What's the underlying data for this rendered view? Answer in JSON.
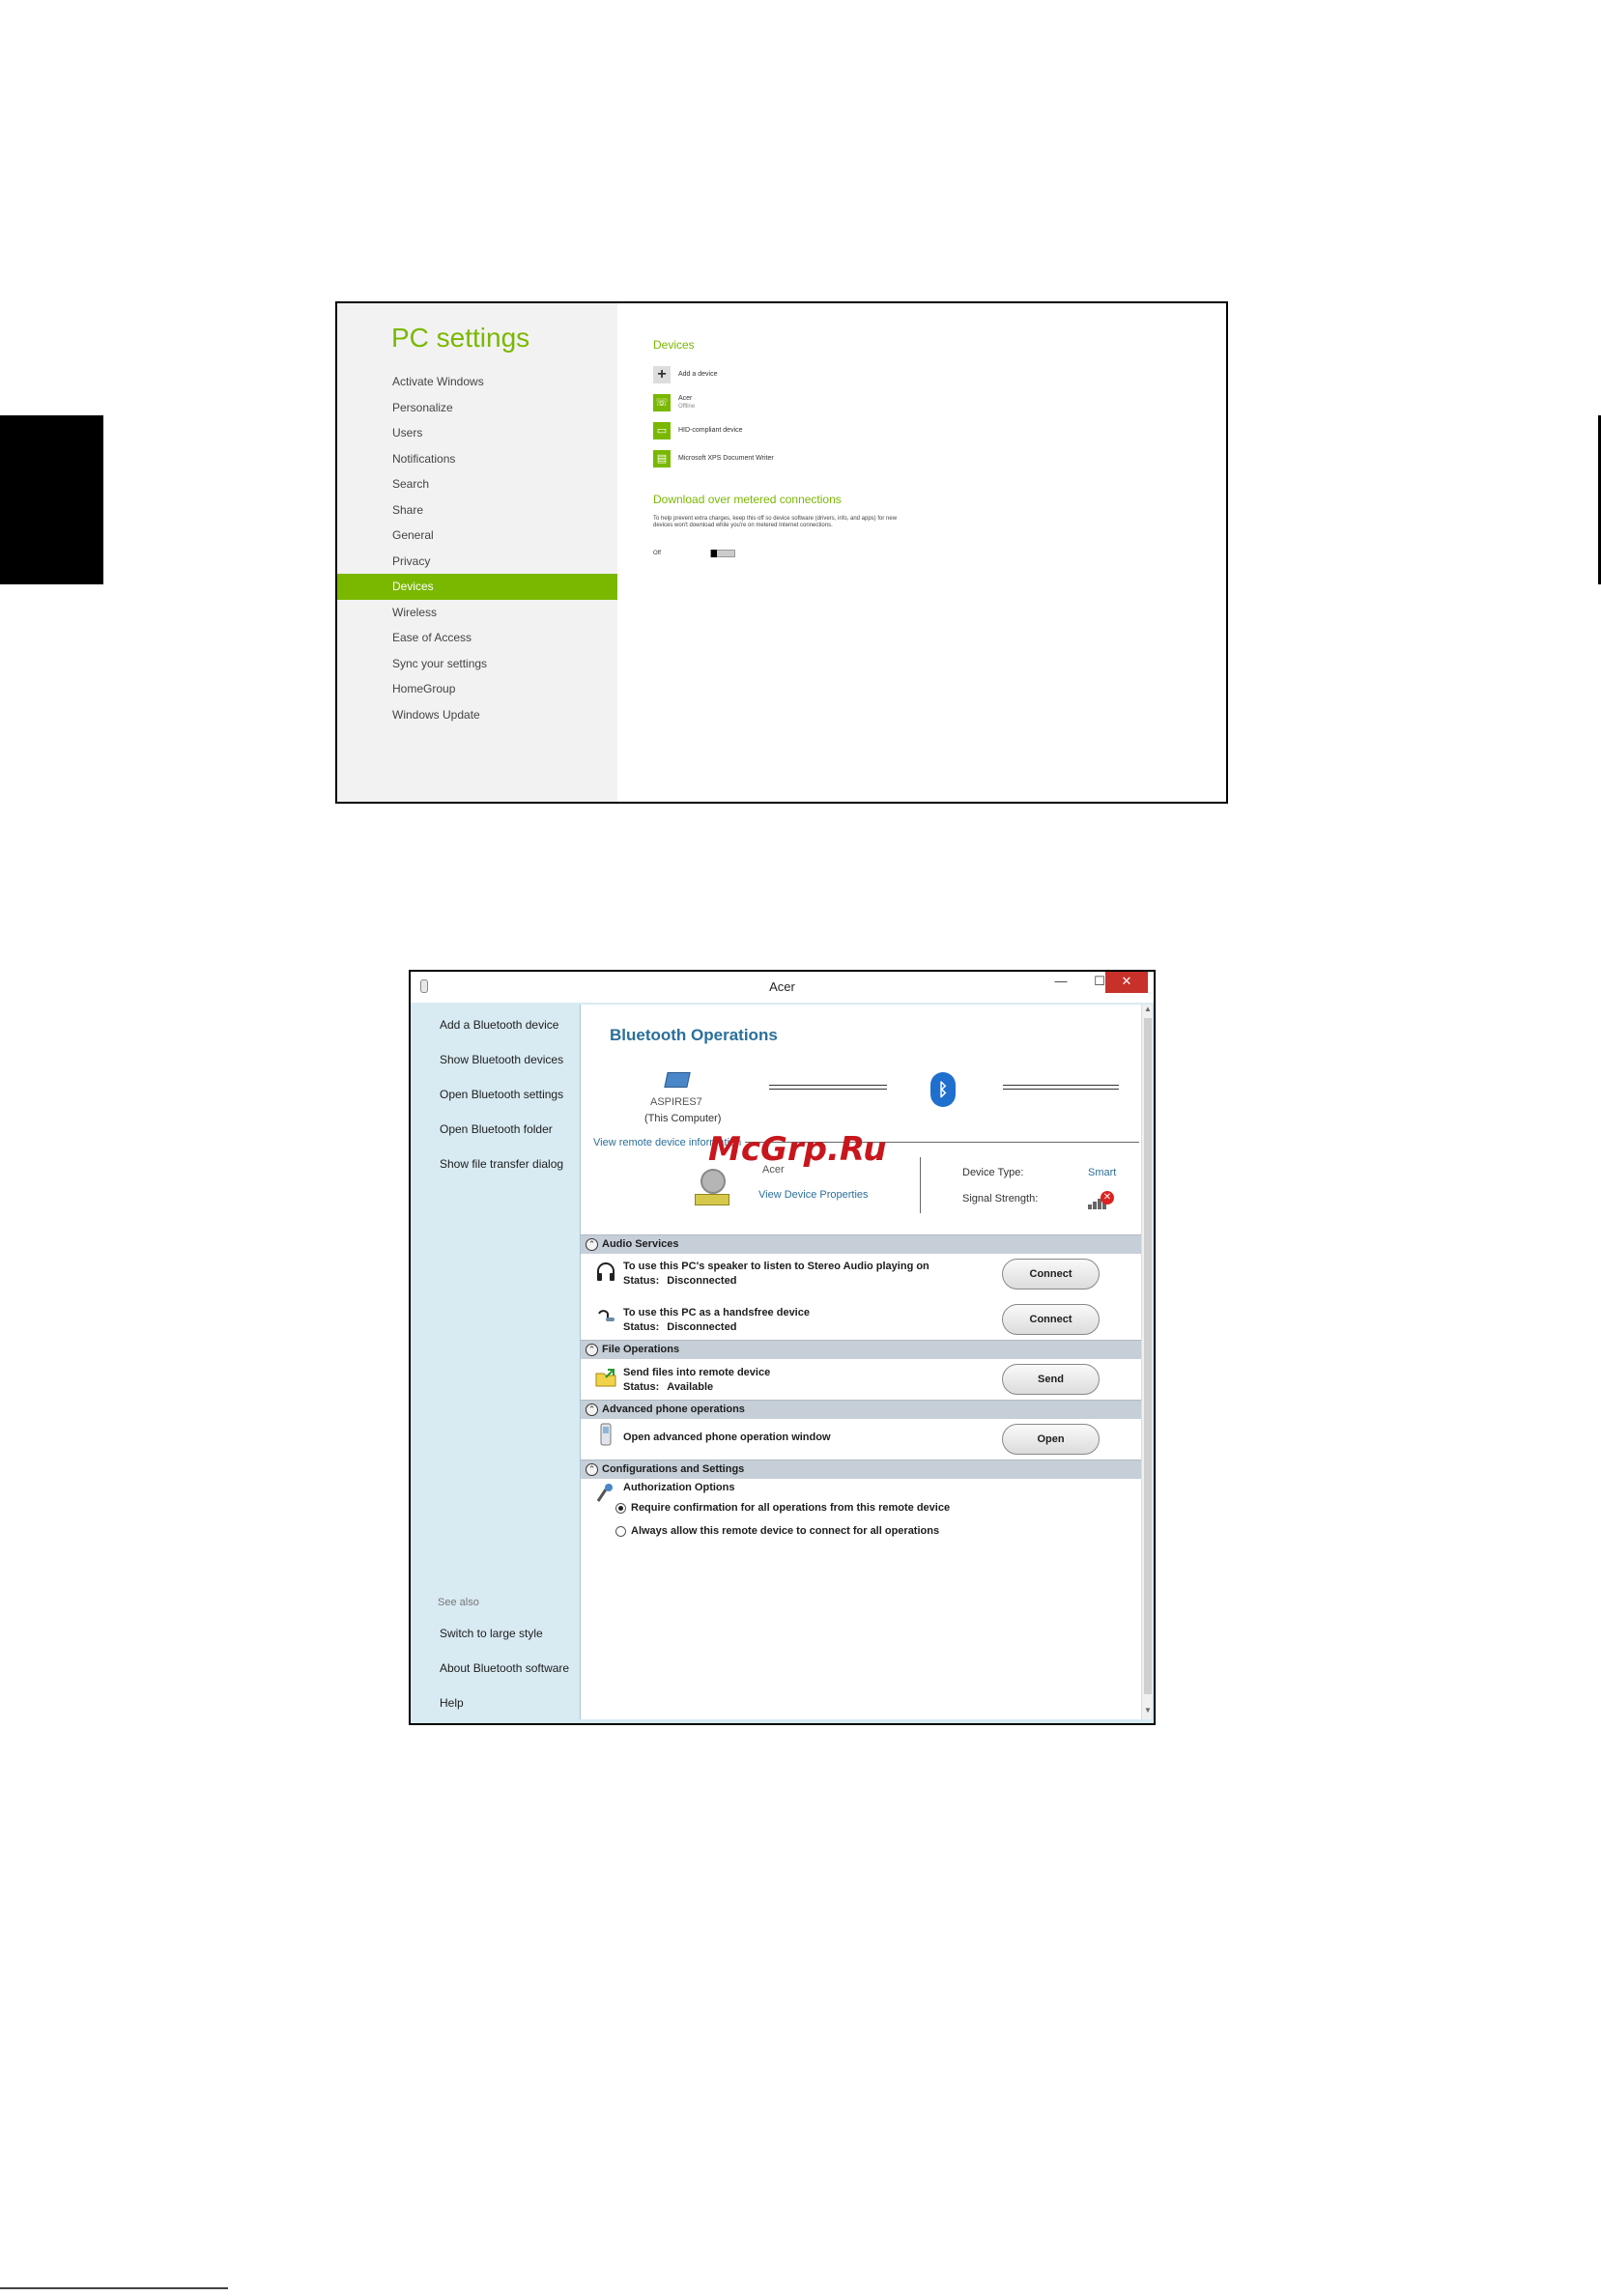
{
  "pc_settings": {
    "title": "PC settings",
    "nav": [
      {
        "label": "Activate Windows"
      },
      {
        "label": "Personalize"
      },
      {
        "label": "Users"
      },
      {
        "label": "Notifications"
      },
      {
        "label": "Search"
      },
      {
        "label": "Share"
      },
      {
        "label": "General"
      },
      {
        "label": "Privacy"
      },
      {
        "label": "Devices",
        "active": true
      },
      {
        "label": "Wireless"
      },
      {
        "label": "Ease of Access"
      },
      {
        "label": "Sync your settings"
      },
      {
        "label": "HomeGroup"
      },
      {
        "label": "Windows Update"
      }
    ],
    "devices_heading": "Devices",
    "add_device": "Add a device",
    "devices": [
      {
        "name": "Acer",
        "status": "Offline"
      },
      {
        "name": "HID-compliant device",
        "status": ""
      },
      {
        "name": "Microsoft XPS Document Writer",
        "status": ""
      }
    ],
    "metered_heading": "Download over metered connections",
    "metered_desc": "To help prevent extra charges, keep this off so device software (drivers, info, and apps) for new devices won't download while you're on metered Internet connections.",
    "metered_toggle_label": "Off",
    "accent_color": "#7ab800"
  },
  "bluetooth": {
    "window_title": "Acer",
    "nav": [
      "Add a Bluetooth device",
      "Show Bluetooth devices",
      "Open Bluetooth settings",
      "Open Bluetooth folder",
      "Show file transfer dialog"
    ],
    "see_also_label": "See also",
    "see_also": [
      "Switch to large style",
      "About Bluetooth software",
      "Help"
    ],
    "heading": "Bluetooth Operations",
    "computer_name": "ASPIRES7",
    "computer_sub": "(This Computer)",
    "remote_link": "View remote device information",
    "device_name": "Acer",
    "device_props_link": "View Device Properties",
    "device_type_label": "Device Type:",
    "device_type_value": "Smart",
    "signal_label": "Signal Strength:",
    "watermark": "McGrp.Ru",
    "sections": {
      "audio": "Audio Services",
      "file": "File Operations",
      "phone": "Advanced phone operations",
      "config": "Configurations and Settings"
    },
    "services": {
      "stereo": {
        "text": "To use this PC's speaker to listen to Stereo Audio playing on",
        "status_label": "Status:",
        "status": "Disconnected",
        "button": "Connect"
      },
      "handsfree": {
        "text": "To use this PC as a handsfree device",
        "status_label": "Status:",
        "status": "Disconnected",
        "button": "Connect"
      },
      "send": {
        "text": "Send files into remote device",
        "status_label": "Status:",
        "status": "Available",
        "button": "Send"
      },
      "phone": {
        "text": "Open advanced phone operation window",
        "button": "Open"
      }
    },
    "auth": {
      "title": "Authorization Options",
      "options": [
        {
          "label": "Require confirmation for all operations from this remote device",
          "selected": true
        },
        {
          "label": "Always allow this remote device to connect for all operations",
          "selected": false
        }
      ]
    },
    "colors": {
      "heading": "#2b6f9a",
      "close_button": "#c7312a",
      "nav_background": "#d8eaf2"
    }
  }
}
